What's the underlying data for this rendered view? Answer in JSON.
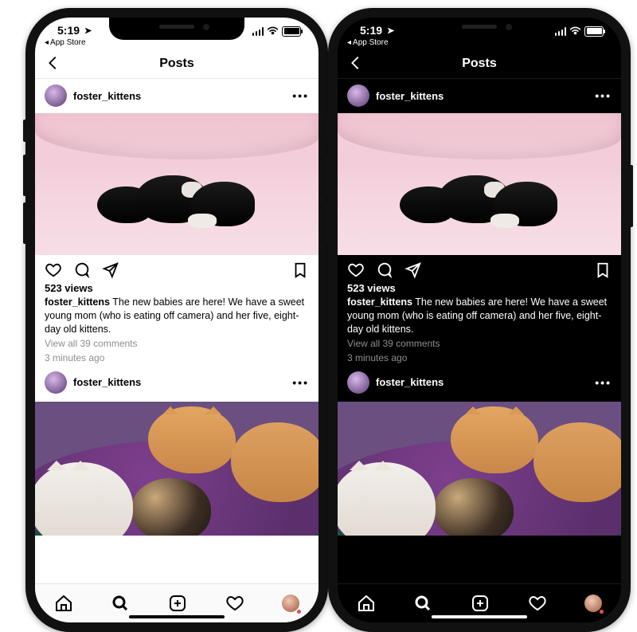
{
  "status": {
    "time": "5:19",
    "back_app": "App Store"
  },
  "nav": {
    "title": "Posts"
  },
  "post": {
    "username": "foster_kittens",
    "views_label": "523 views",
    "caption": "The new babies are here! We have a sweet young mom (who is eating off camera) and her five, eight-day old kittens.",
    "comments_label": "View all 39 comments",
    "time_label": "3 minutes ago"
  },
  "post2": {
    "username": "foster_kittens"
  }
}
